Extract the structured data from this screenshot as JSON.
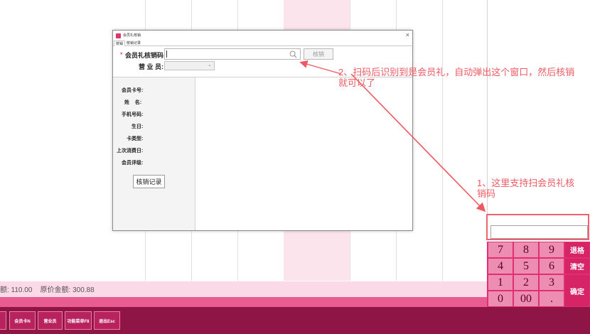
{
  "background": {
    "amount_text": "额: 110.00    原价金额: 300.88"
  },
  "function_keys": [
    "",
    "会员卡N",
    "营业员",
    "功能菜单F8",
    "退出Esc"
  ],
  "keypad": {
    "row1": [
      "7",
      "8",
      "9"
    ],
    "row2": [
      "4",
      "5",
      "6"
    ],
    "row3": [
      "1",
      "2",
      "3"
    ],
    "row4": [
      "0",
      "00",
      "."
    ],
    "side": [
      "退格",
      "清空",
      "确定"
    ]
  },
  "dialog": {
    "title": "会员礼核销",
    "close": "×",
    "tabs": [
      "核销",
      "核销记录"
    ],
    "required_mark": "*",
    "code_label": "会员礼核销码:",
    "verify_button": "核销",
    "staff_label": "营 业 员:",
    "staff_chevron": "⌄",
    "info_labels": [
      "会员卡号:",
      "姓    名:",
      "手机号码:",
      "生日:",
      "卡类型:",
      "上次消费日:",
      "会员评级:"
    ],
    "record_button": "核销记录"
  },
  "annotations": {
    "a1_line1": "2、扫码后识别到是会员礼，自动弹出这个窗口，然后核销",
    "a1_line2": "就可以了",
    "a2_line1": "1、这里支持扫会员礼核",
    "a2_line2": "销码"
  },
  "colors": {
    "annotation": "#ee5a62",
    "keypad_bg": "#e12f73",
    "bottom_bar": "#8e1545"
  }
}
